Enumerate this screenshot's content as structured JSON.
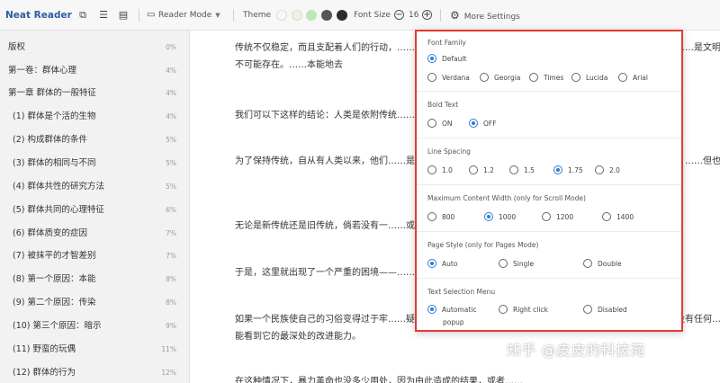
{
  "app": {
    "name": "Neat Reader"
  },
  "toolbar": {
    "reading_mode": "Reader Mode",
    "theme_label": "Theme",
    "theme_swatches": [
      "#f8f8f2",
      "#eaf3e2",
      "#bfe6b4",
      "#555555",
      "#2b2b2b"
    ],
    "font_size_label": "Font Size",
    "font_size_value": "16",
    "more_settings": "More Settings"
  },
  "sidebar": {
    "items": [
      {
        "label": "版权",
        "percent": "0%"
      },
      {
        "label": "第一卷：群体心理",
        "percent": "4%"
      },
      {
        "label": "第一章 群体的一般特征",
        "percent": "4%"
      },
      {
        "label": "(1) 群体是个活的生物",
        "percent": "4%"
      },
      {
        "label": "(2) 构成群体的条件",
        "percent": "5%"
      },
      {
        "label": "(3) 群体的相同与不同",
        "percent": "5%"
      },
      {
        "label": "(4) 群体共性的研究方法",
        "percent": "5%"
      },
      {
        "label": "(5) 群体共同的心理特征",
        "percent": "6%"
      },
      {
        "label": "(6) 群体质变的症因",
        "percent": "7%"
      },
      {
        "label": "(7) 被抹平的才智差别",
        "percent": "7%"
      },
      {
        "label": "(8) 第一个原因：本能",
        "percent": "8%"
      },
      {
        "label": "(9) 第二个原因：传染",
        "percent": "8%"
      },
      {
        "label": "(10) 第三个原因：暗示",
        "percent": "9%"
      },
      {
        "label": "(11) 野蛮的玩偶",
        "percent": "11%"
      },
      {
        "label": "(12) 群体的行为",
        "percent": "12%"
      }
    ]
  },
  "content": {
    "paragraphs": [
      "传统不仅稳定，而且支配着人们的行动，……不容易变更。更是如此。对这种状况不必感到遗憾，……使它变得……是文明，都不可能存在。……本能地去",
      "我们可以下这样的结论：人类是依附传统……论述过，传统，不管民族气质还是文明，都不可……念不放，",
      "为了保持传统，自从有人类以来，他们……是最狂野立传统，二是当有益的成果已变得破败……纪末，这种传统。……但也许",
      "无论是新传统还是旧传统，倘若没有一……或普遍的续；而如果没有新的传统，文明也不可……训传统，",
      "于是，这里就出现了一个严重的困境——……统对群体得平衡。",
      "如果一个民族使自己的习俗变得过于牢……疑的偶像国是这方面的典型，它死气沉沉的固有习俗，使得整个国家没有任何……文能看到它的最深处的改进能力。",
      "在这种情况下，暴力革命也没多少用处，因为由此造成的结果，或者……"
    ],
    "watermark": "知乎 @皮皮的科技苑"
  },
  "settings": {
    "font_family": {
      "title": "Font Family",
      "default_label": "Default",
      "options": [
        "Verdana",
        "Georgia",
        "Times",
        "Lucida",
        "Arial"
      ],
      "selected": "Default"
    },
    "bold_text": {
      "title": "Bold Text",
      "options": [
        "ON",
        "OFF"
      ],
      "selected": "OFF"
    },
    "line_spacing": {
      "title": "Line Spacing",
      "options": [
        "1.0",
        "1.2",
        "1.5",
        "1.75",
        "2.0"
      ],
      "selected": "1.75"
    },
    "max_content_width": {
      "title": "Maximum Content Width (only for Scroll Mode)",
      "options": [
        "800",
        "1000",
        "1200",
        "1400"
      ],
      "selected": "1000"
    },
    "page_style": {
      "title": "Page Style (only for Pages Mode)",
      "options": [
        "Auto",
        "Single",
        "Double"
      ],
      "selected": "Auto"
    },
    "text_selection_menu": {
      "title": "Text Selection Menu",
      "options": [
        "Automatic",
        "Right click",
        "Disabled"
      ],
      "automatic_sub": "popup",
      "selected": "Automatic"
    }
  },
  "colors": {
    "accent": "#2f7bd6",
    "highlight_border": "#e53935",
    "brand": "#2d5d9f"
  }
}
